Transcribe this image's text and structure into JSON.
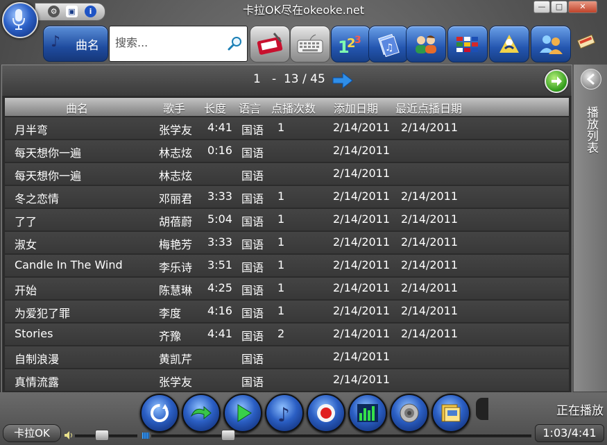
{
  "window": {
    "title": "卡拉OK尽在okeoke.net",
    "controls": [
      "—",
      "□",
      "✕"
    ]
  },
  "top_icons": [
    "gear-icon",
    "save-icon",
    "info-icon"
  ],
  "toolbar": {
    "active_tab_label": "曲名",
    "search_placeholder": "搜索...",
    "tools": [
      "eraser-tool-icon",
      "keyboard-icon",
      "number-icon",
      "music-book-icon",
      "singers-icon",
      "flags-icon",
      "dance-icon",
      "group-icon"
    ]
  },
  "pager": {
    "text": "1   -  13 / 45"
  },
  "table": {
    "columns": [
      "曲名",
      "歌手",
      "长度",
      "语言",
      "点播次数",
      "添加日期",
      "最近点播日期"
    ],
    "rows": [
      [
        "月半弯",
        "张学友",
        "4:41",
        "国语",
        "1",
        "2/14/2011",
        "2/14/2011"
      ],
      [
        "每天想你一遍",
        "林志炫",
        "0:16",
        "国语",
        "",
        "2/14/2011",
        ""
      ],
      [
        "每天想你一遍",
        "林志炫",
        "",
        "国语",
        "",
        "2/14/2011",
        ""
      ],
      [
        "冬之恋情",
        "邓丽君",
        "3:33",
        "国语",
        "1",
        "2/14/2011",
        "2/14/2011"
      ],
      [
        "了了",
        "胡蓓蔚",
        "5:04",
        "国语",
        "1",
        "2/14/2011",
        "2/14/2011"
      ],
      [
        "淑女",
        "梅艳芳",
        "3:33",
        "国语",
        "1",
        "2/14/2011",
        "2/14/2011"
      ],
      [
        "Candle In The Wind",
        "李乐诗",
        "3:51",
        "国语",
        "1",
        "2/14/2011",
        "2/14/2011"
      ],
      [
        "开始",
        "陈慧琳",
        "4:25",
        "国语",
        "1",
        "2/14/2011",
        "2/14/2011"
      ],
      [
        "为爱犯了罪",
        "李度",
        "4:16",
        "国语",
        "1",
        "2/14/2011",
        "2/14/2011"
      ],
      [
        "Stories",
        "齐豫",
        "4:41",
        "国语",
        "2",
        "2/14/2011",
        "2/14/2011"
      ],
      [
        "自制浪漫",
        "黄凯芹",
        "",
        "国语",
        "",
        "2/14/2011",
        ""
      ],
      [
        "真情流露",
        "张学友",
        "",
        "国语",
        "",
        "2/14/2011",
        ""
      ]
    ]
  },
  "side": {
    "playlist_label": "播放列表"
  },
  "bottom": {
    "karaoke_label": "卡拉OK",
    "now_playing": "正在播放",
    "time": "1:03/4:41",
    "volume_fraction": 0.42,
    "seek_fraction": 0.2
  },
  "colors": {
    "accent_blue": "#2456b0",
    "panel_bg": "#2b2b2b",
    "row_bg": "#3d3d3d",
    "go_green": "#2f9a1a"
  }
}
